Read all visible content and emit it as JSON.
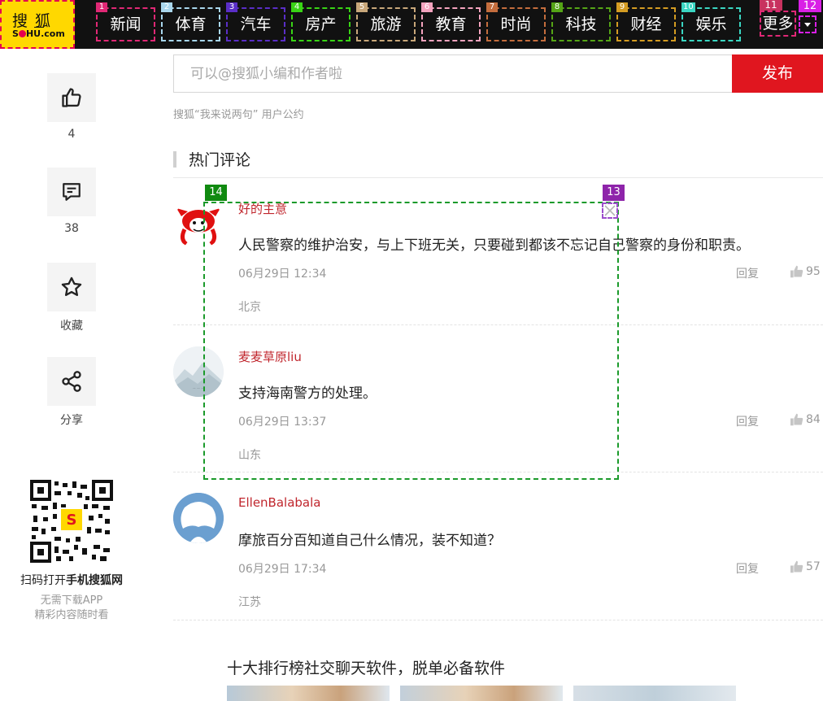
{
  "nav": {
    "logo_top": "搜狐",
    "logo_bottom_left": "S",
    "logo_bottom_right": "HU.com",
    "items": [
      {
        "badge": "1",
        "label": "新闻",
        "color": "#e02875"
      },
      {
        "badge": "2",
        "label": "体育",
        "color": "#a8d6ec"
      },
      {
        "badge": "3",
        "label": "汽车",
        "color": "#5a2ec7"
      },
      {
        "badge": "4",
        "label": "房产",
        "color": "#39d415"
      },
      {
        "badge": "5",
        "label": "旅游",
        "color": "#c8a77a"
      },
      {
        "badge": "6",
        "label": "教育",
        "color": "#f4a3be"
      },
      {
        "badge": "7",
        "label": "时尚",
        "color": "#c46d3d"
      },
      {
        "badge": "8",
        "label": "科技",
        "color": "#55a516"
      },
      {
        "badge": "9",
        "label": "财经",
        "color": "#d49c22"
      },
      {
        "badge": "10",
        "label": "娱乐",
        "color": "#3ad6c2"
      }
    ],
    "more_badge": "11",
    "more_label": "更多",
    "dropdown_badge": "12"
  },
  "sidebar": {
    "like_count": "4",
    "comment_count": "38",
    "collect_label": "收藏",
    "share_label": "分享",
    "qr_caption_main": "扫码打开",
    "qr_caption_bold": "手机搜狐网",
    "qr_sub1": "无需下载APP",
    "qr_sub2": "精彩内容随时看"
  },
  "composer": {
    "placeholder": "可以@搜狐小编和作者啦",
    "publish_label": "发布",
    "rules_link": "搜狐“我来说两句” 用户公约"
  },
  "hot_comments": {
    "title": "热门评论",
    "items": [
      {
        "user": "好的主意",
        "text": "人民警察的维护治安，与上下班无关，只要碰到都该不忘记自己警察的身份和职责。",
        "time": "06月29日 12:34",
        "location": "北京",
        "reply": "回复",
        "likes": "95"
      },
      {
        "user": "麦麦草原liu",
        "text": "支持海南警方的处理。",
        "time": "06月29日 13:37",
        "location": "山东",
        "reply": "回复",
        "likes": "84"
      },
      {
        "user": "EllenBalabala",
        "text": "摩旅百分百知道自己什么情况，装不知道？",
        "time": "06月29日 17:34",
        "location": "江苏",
        "reply": "回复",
        "likes": "57"
      }
    ]
  },
  "overlays": {
    "box14_badge": "14",
    "box13_badge": "13"
  },
  "recommend": {
    "title": "十大排行榜社交聊天软件，脱单必备软件"
  },
  "colors": {
    "brand_red": "#e0161f",
    "username_red": "#c0262d",
    "logo_yellow": "#ffd800",
    "nav_bg": "#111111"
  }
}
